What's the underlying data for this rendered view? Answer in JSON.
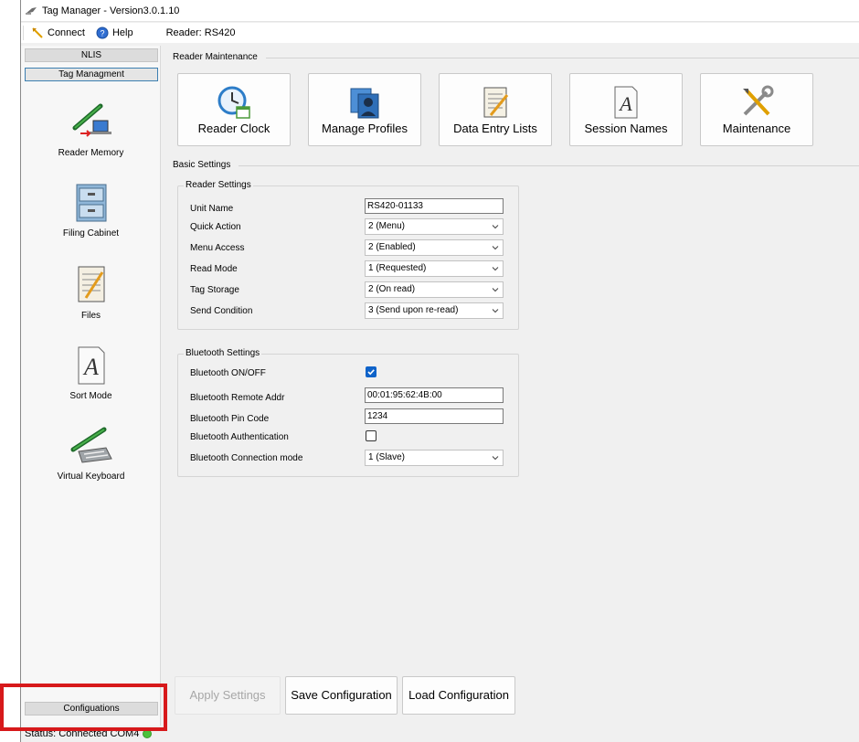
{
  "window": {
    "title": "Tag Manager - Version3.0.1.10"
  },
  "toolbar": {
    "connect_label": "Connect",
    "help_label": "Help",
    "reader_label": "Reader: RS420"
  },
  "nav": {
    "nlis_label": "NLIS",
    "tag_management_label": "Tag Managment",
    "items": [
      {
        "label": "Reader Memory",
        "icon": "reader-memory-icon"
      },
      {
        "label": "Filing Cabinet",
        "icon": "filing-cabinet-icon"
      },
      {
        "label": "Files",
        "icon": "files-icon"
      },
      {
        "label": "Sort Mode",
        "icon": "sort-mode-icon"
      },
      {
        "label": "Virtual Keyboard",
        "icon": "virtual-keyboard-icon"
      }
    ],
    "configurations_label": "Configuations"
  },
  "reader_maintenance": {
    "title": "Reader Maintenance",
    "buttons": [
      {
        "label": "Reader Clock",
        "icon": "clock-icon"
      },
      {
        "label": "Manage Profiles",
        "icon": "profiles-icon"
      },
      {
        "label": "Data Entry Lists",
        "icon": "data-entry-icon"
      },
      {
        "label": "Session Names",
        "icon": "session-names-icon"
      },
      {
        "label": "Maintenance",
        "icon": "tools-icon"
      }
    ]
  },
  "basic_settings": {
    "title": "Basic Settings",
    "reader_settings": {
      "title": "Reader Settings",
      "unit_name_label": "Unit Name",
      "unit_name_value": "RS420-01133",
      "quick_action_label": "Quick Action",
      "quick_action_value": "2 (Menu)",
      "menu_access_label": "Menu Access",
      "menu_access_value": "2 (Enabled)",
      "read_mode_label": "Read Mode",
      "read_mode_value": "1 (Requested)",
      "tag_storage_label": "Tag Storage",
      "tag_storage_value": "2 (On read)",
      "send_condition_label": "Send Condition",
      "send_condition_value": "3 (Send upon re-read)"
    },
    "bluetooth_settings": {
      "title": "Bluetooth Settings",
      "onoff_label": "Bluetooth ON/OFF",
      "onoff_checked": true,
      "remote_addr_label": "Bluetooth Remote Addr",
      "remote_addr_value": "00:01:95:62:4B:00",
      "pin_code_label": "Bluetooth Pin Code",
      "pin_code_value": "1234",
      "authentication_label": "Bluetooth Authentication",
      "authentication_checked": false,
      "connection_mode_label": "Bluetooth Connection mode",
      "connection_mode_value": "1 (Slave)"
    }
  },
  "actions": {
    "apply_label": "Apply Settings",
    "save_label": "Save Configuration",
    "load_label": "Load Configuration"
  },
  "status": {
    "text": "Status: Connected COM4"
  },
  "colors": {
    "accent": "#0f63c9",
    "highlight": "#d7191b",
    "connected": "#4cc23b"
  }
}
